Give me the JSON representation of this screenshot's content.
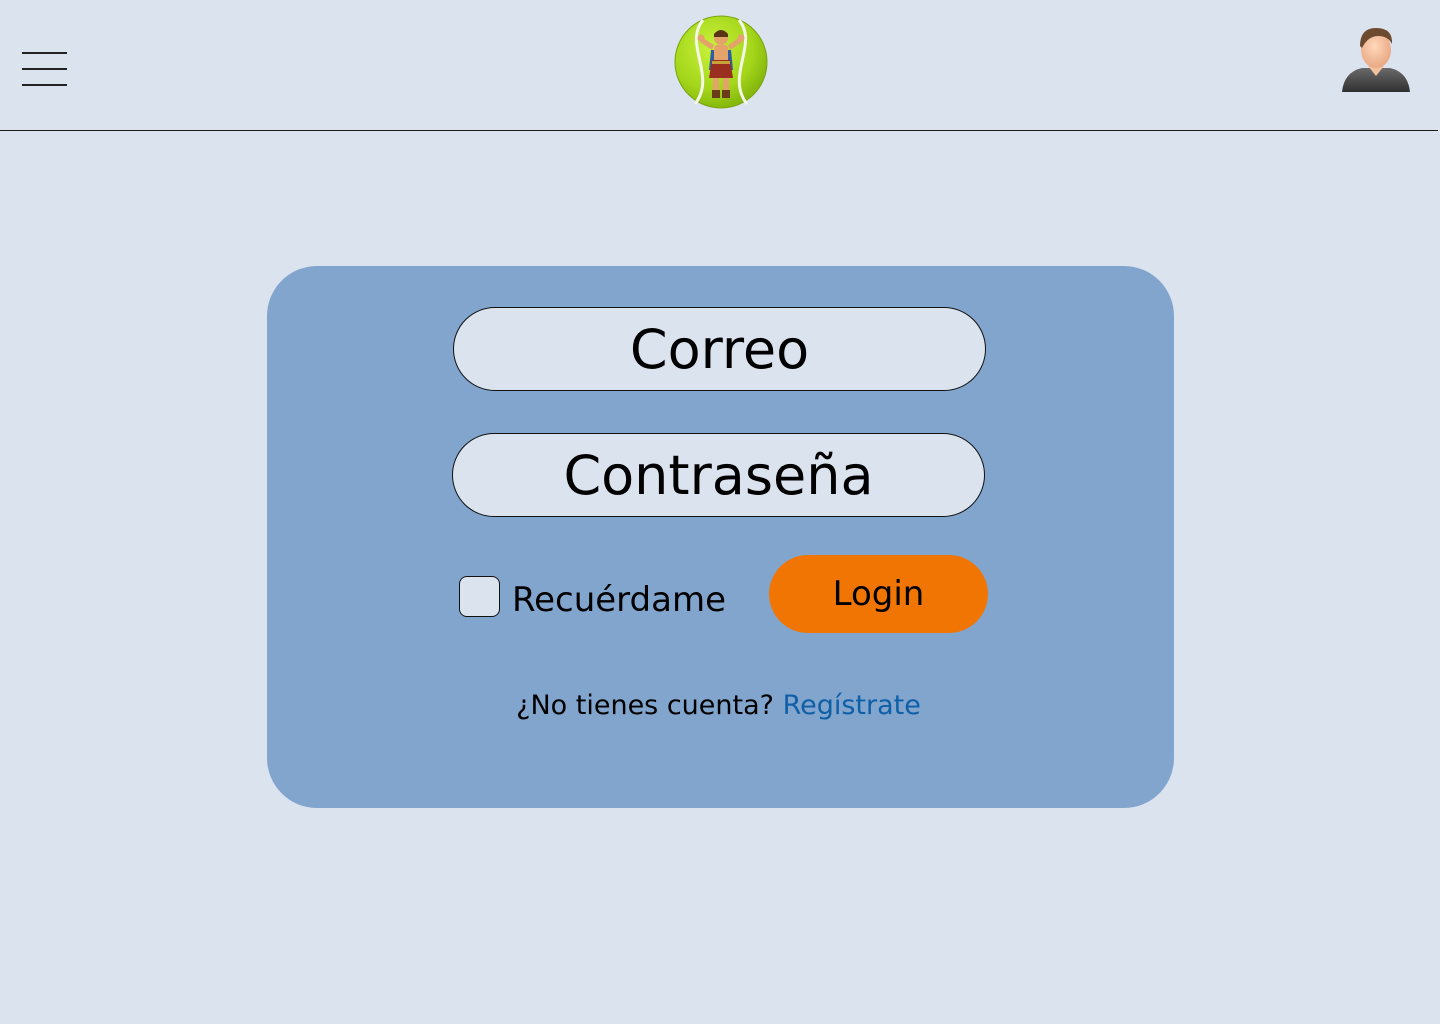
{
  "header": {
    "menu_icon": "hamburger-menu-icon",
    "logo_icon": "tennis-ball-hercules-logo",
    "user_icon": "user-avatar-icon"
  },
  "login_form": {
    "email_placeholder": "Correo",
    "password_placeholder": "Contraseña",
    "remember_label": "Recuérdame",
    "remember_checked": false,
    "login_button_label": "Login",
    "register_prompt": "¿No tienes cuenta?",
    "register_link": "Regístrate"
  },
  "colors": {
    "background": "#dbe3ef",
    "card": "#81a5cd",
    "login_button": "#f07502",
    "link": "#0f5fa8"
  }
}
